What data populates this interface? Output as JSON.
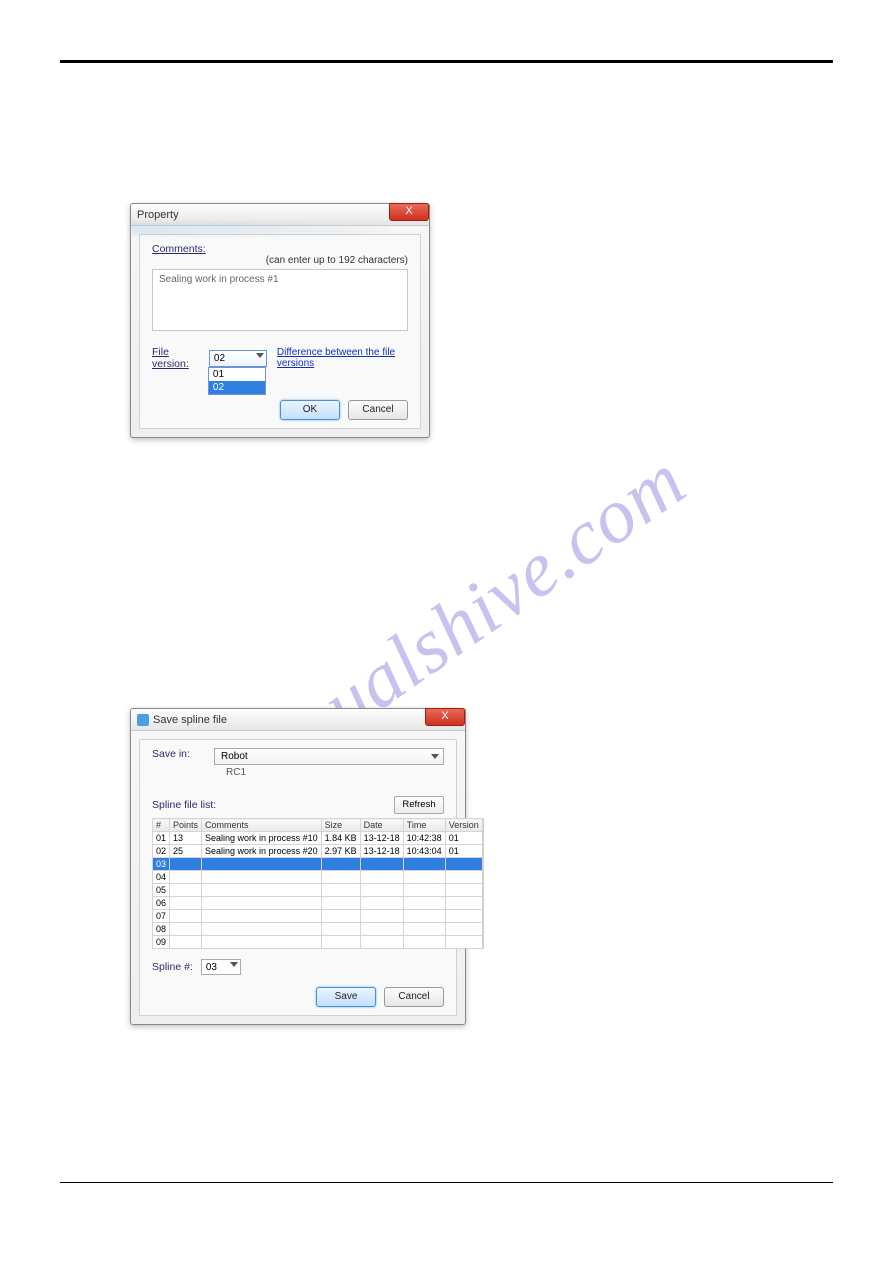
{
  "watermark": "manualshive.com",
  "dialog1": {
    "title": "Property",
    "close": "X",
    "comments_label": "Comments:",
    "hint": "(can enter up to 192 characters)",
    "comment_value": "Sealing work in process #1",
    "file_version_label": "File version:",
    "file_version_value": "02",
    "file_version_options": [
      "01",
      "02"
    ],
    "link": "Difference between the file versions",
    "ok": "OK",
    "cancel": "Cancel"
  },
  "dialog2": {
    "title": "Save spline file",
    "close": "X",
    "save_in_label": "Save in:",
    "save_in_value": "Robot",
    "save_in_sub": "RC1",
    "list_label": "Spline file list:",
    "refresh": "Refresh",
    "columns": [
      "#",
      "Points",
      "Comments",
      "Size",
      "Date",
      "Time",
      "Version"
    ],
    "rows": [
      {
        "id": "01",
        "points": "13",
        "comments": "Sealing work in process #10",
        "size": "1.84 KB",
        "date": "13-12-18",
        "time": "10:42:38",
        "version": "01",
        "selected": false
      },
      {
        "id": "02",
        "points": "25",
        "comments": "Sealing work in process #20",
        "size": "2.97 KB",
        "date": "13-12-18",
        "time": "10:43:04",
        "version": "01",
        "selected": false
      },
      {
        "id": "03",
        "points": "",
        "comments": "",
        "size": "",
        "date": "",
        "time": "",
        "version": "",
        "selected": true
      },
      {
        "id": "04",
        "points": "",
        "comments": "",
        "size": "",
        "date": "",
        "time": "",
        "version": "",
        "selected": false
      },
      {
        "id": "05",
        "points": "",
        "comments": "",
        "size": "",
        "date": "",
        "time": "",
        "version": "",
        "selected": false
      },
      {
        "id": "06",
        "points": "",
        "comments": "",
        "size": "",
        "date": "",
        "time": "",
        "version": "",
        "selected": false
      },
      {
        "id": "07",
        "points": "",
        "comments": "",
        "size": "",
        "date": "",
        "time": "",
        "version": "",
        "selected": false
      },
      {
        "id": "08",
        "points": "",
        "comments": "",
        "size": "",
        "date": "",
        "time": "",
        "version": "",
        "selected": false
      },
      {
        "id": "09",
        "points": "",
        "comments": "",
        "size": "",
        "date": "",
        "time": "",
        "version": "",
        "selected": false
      }
    ],
    "spline_num_label": "Spline #:",
    "spline_num_value": "03",
    "save": "Save",
    "cancel": "Cancel"
  }
}
